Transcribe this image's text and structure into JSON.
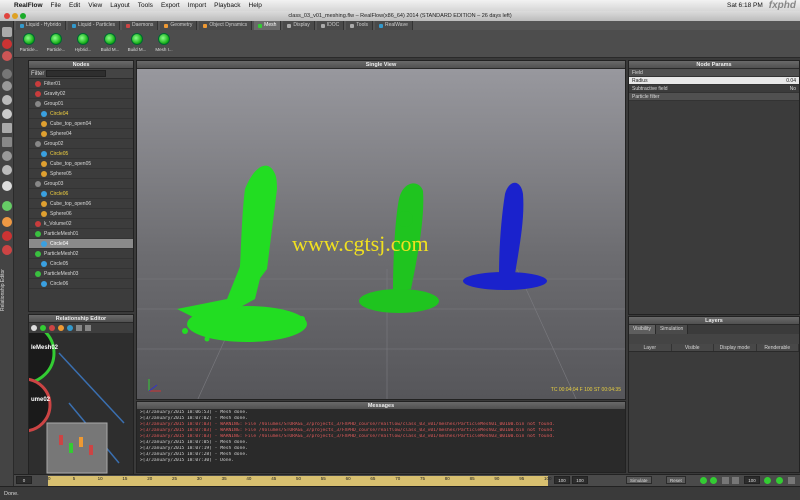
{
  "menubar": {
    "app": "RealFlow",
    "items": [
      "File",
      "Edit",
      "View",
      "Layout",
      "Tools",
      "Export",
      "Import",
      "Playback",
      "Help"
    ],
    "clock": "Sat 6:18 PM",
    "brand": "fxphd"
  },
  "window_title": "class_03_v01_meshing.flw – RealFlow(x86_64) 2014 (STANDARD EDITION – 26 days left)",
  "tabs": [
    {
      "label": "Liquid - Hybrido",
      "active": false
    },
    {
      "label": "Liquid - Particles",
      "active": false
    },
    {
      "label": "Daemons",
      "active": false
    },
    {
      "label": "Geometry",
      "active": false
    },
    {
      "label": "Object Dynamics",
      "active": false
    },
    {
      "label": "Mesh",
      "active": true
    },
    {
      "label": "Display",
      "active": false
    },
    {
      "label": "IDOC",
      "active": false
    },
    {
      "label": "Tools",
      "active": false
    },
    {
      "label": "RealWave",
      "active": false
    }
  ],
  "shelf": [
    "Particle...",
    "Particle...",
    "Hybrid...",
    "Build M...",
    "Build M...",
    "Mesh I..."
  ],
  "nodes_panel": {
    "title": "Nodes",
    "filter_label": "Filter",
    "items": [
      {
        "label": "Filter01",
        "indent": 0,
        "color": "#c83c3c",
        "selected": false,
        "highlight": false
      },
      {
        "label": "Gravity02",
        "indent": 0,
        "color": "#c83c3c",
        "selected": false,
        "highlight": false
      },
      {
        "label": "Group01",
        "indent": 0,
        "color": "#888888",
        "selected": false,
        "highlight": false
      },
      {
        "label": "Circle04",
        "indent": 1,
        "color": "#3aa0e0",
        "selected": false,
        "highlight": true
      },
      {
        "label": "Cube_top_open04",
        "indent": 1,
        "color": "#e0a030",
        "selected": false,
        "highlight": false
      },
      {
        "label": "Sphere04",
        "indent": 1,
        "color": "#e0a030",
        "selected": false,
        "highlight": false
      },
      {
        "label": "Group02",
        "indent": 0,
        "color": "#888888",
        "selected": false,
        "highlight": false
      },
      {
        "label": "Circle05",
        "indent": 1,
        "color": "#3aa0e0",
        "selected": false,
        "highlight": true
      },
      {
        "label": "Cube_top_open05",
        "indent": 1,
        "color": "#e0a030",
        "selected": false,
        "highlight": false
      },
      {
        "label": "Sphere05",
        "indent": 1,
        "color": "#e0a030",
        "selected": false,
        "highlight": false
      },
      {
        "label": "Group03",
        "indent": 0,
        "color": "#888888",
        "selected": false,
        "highlight": false
      },
      {
        "label": "Circle06",
        "indent": 1,
        "color": "#3aa0e0",
        "selected": false,
        "highlight": true
      },
      {
        "label": "Cube_top_open06",
        "indent": 1,
        "color": "#e0a030",
        "selected": false,
        "highlight": false
      },
      {
        "label": "Sphere06",
        "indent": 1,
        "color": "#e0a030",
        "selected": false,
        "highlight": false
      },
      {
        "label": "k_Volume02",
        "indent": 0,
        "color": "#c83c3c",
        "selected": false,
        "highlight": false
      },
      {
        "label": "ParticleMesh01",
        "indent": 0,
        "color": "#3ac040",
        "selected": false,
        "highlight": false
      },
      {
        "label": "Circle04",
        "indent": 1,
        "color": "#3aa0e0",
        "selected": true,
        "highlight": false
      },
      {
        "label": "ParticleMesh02",
        "indent": 0,
        "color": "#3ac040",
        "selected": false,
        "highlight": false
      },
      {
        "label": "Circle05",
        "indent": 1,
        "color": "#3aa0e0",
        "selected": false,
        "highlight": false
      },
      {
        "label": "ParticleMesh03",
        "indent": 0,
        "color": "#3ac040",
        "selected": false,
        "highlight": false
      },
      {
        "label": "Circle06",
        "indent": 1,
        "color": "#3aa0e0",
        "selected": false,
        "highlight": false
      }
    ]
  },
  "relationship_editor": {
    "title": "Relationship Editor",
    "side_label": "Relationship Editor",
    "node_a": "leMesh02",
    "node_b": "ume02"
  },
  "viewport": {
    "title": "Single View",
    "watermark": "www.cgtsj.com",
    "hud": "TC 00:04:04   F 100   ST 00:04:35",
    "colors": {
      "left": "#22dd22",
      "middle": "#22cc22",
      "right": "#1a22cc"
    }
  },
  "messages": {
    "title": "Messages",
    "lines": [
      {
        "text": ">[3/January/2015 18:06:53] - Mesh done.",
        "warn": false
      },
      {
        "text": ">[3/January/2015 18:07:02] - Mesh done.",
        "warn": false
      },
      {
        "text": ">[3/January/2015 18:07:03] - WARNING: File /Volumes/STORAGE_3/projects_3/FXPHD_course/realflow/class_03_v01/meshes/ParticleMesh01_00100.bin not found.",
        "warn": true
      },
      {
        "text": ">[3/January/2015 18:07:03] - WARNING: File /Volumes/STORAGE_3/projects_3/FXPHD_course/realflow/class_03_v01/meshes/ParticleMesh02_00100.bin not found.",
        "warn": true
      },
      {
        "text": ">[3/January/2015 18:07:03] - WARNING: File /Volumes/STORAGE_3/projects_3/FXPHD_course/realflow/class_03_v01/meshes/ParticleMesh03_00100.bin not found.",
        "warn": true
      },
      {
        "text": ">[3/January/2015 18:07:05] - Mesh done.",
        "warn": false
      },
      {
        "text": ">[3/January/2015 18:07:19] - Mesh done.",
        "warn": false
      },
      {
        "text": ">[3/January/2015 18:07:28] - Mesh done.",
        "warn": false
      },
      {
        "text": ">[3/January/2015 18:07:30] - Done.",
        "warn": false
      }
    ]
  },
  "node_params": {
    "title": "Node Params",
    "section": "Field",
    "rows": [
      {
        "label": "Radius",
        "value": "0.04"
      },
      {
        "label": "Subtractive field",
        "value": "No"
      }
    ],
    "section2": "Particle filter"
  },
  "layers": {
    "title": "Layers",
    "tabs": [
      "Visibility",
      "Simulation"
    ],
    "columns": [
      "Layer",
      "Visible",
      "Display mode",
      "Renderable"
    ]
  },
  "timeline": {
    "ticks": [
      "0",
      "5",
      "10",
      "15",
      "20",
      "25",
      "30",
      "35",
      "40",
      "45",
      "50",
      "55",
      "60",
      "65",
      "70",
      "75",
      "80",
      "85",
      "90",
      "95",
      "100"
    ],
    "current": "100",
    "end": "100",
    "simulate_label": "Simulate",
    "reset_label": "Reset",
    "frame": "100"
  },
  "status": "Done."
}
